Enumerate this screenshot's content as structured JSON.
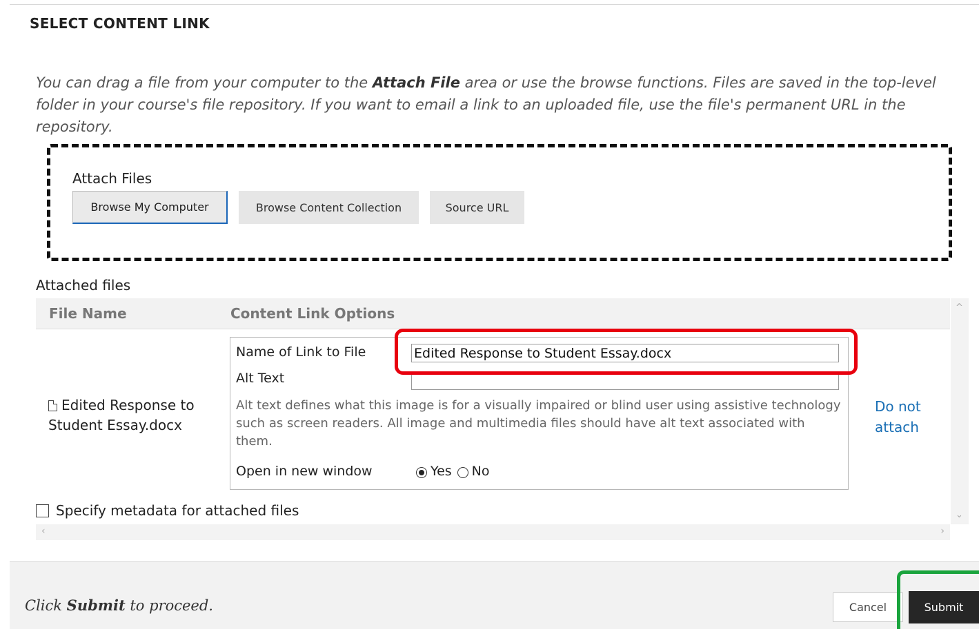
{
  "section_title": "SELECT CONTENT LINK",
  "instructions": {
    "part1": "You can drag a file from your computer to the ",
    "bold": "Attach File",
    "part2": " area or use the browse functions. Files are saved in the top-level folder in your course's file repository. If you want to email a link to an uploaded file, use the file's permanent URL in the repository."
  },
  "attach": {
    "label": "Attach Files",
    "browse_computer": "Browse My Computer",
    "browse_collection": "Browse Content Collection",
    "source_url": "Source URL"
  },
  "attached": {
    "label": "Attached files",
    "col_file_name": "File Name",
    "col_options": "Content Link Options",
    "file_name": "Edited Response to Student Essay.docx",
    "name_label": "Name of Link to File",
    "name_value": "Edited Response to Student Essay.docx",
    "alt_label": "Alt Text",
    "alt_value": "",
    "alt_help": "Alt text defines what this image is for a visually impaired or blind user using assistive technology such as screen readers. All image and multimedia files should have alt text associated with them.",
    "window_label": "Open in new window",
    "yes": "Yes",
    "no": "No",
    "remove": "Do not attach"
  },
  "metadata_label": "Specify metadata for attached files",
  "footer": {
    "msg_prefix": "Click ",
    "msg_bold": "Submit",
    "msg_suffix": " to proceed.",
    "cancel": "Cancel",
    "submit": "Submit"
  },
  "colors": {
    "highlight_red": "#e8000e",
    "highlight_green": "#1aa43d",
    "link_blue": "#1a6fb5",
    "submit_bg": "#262626"
  }
}
